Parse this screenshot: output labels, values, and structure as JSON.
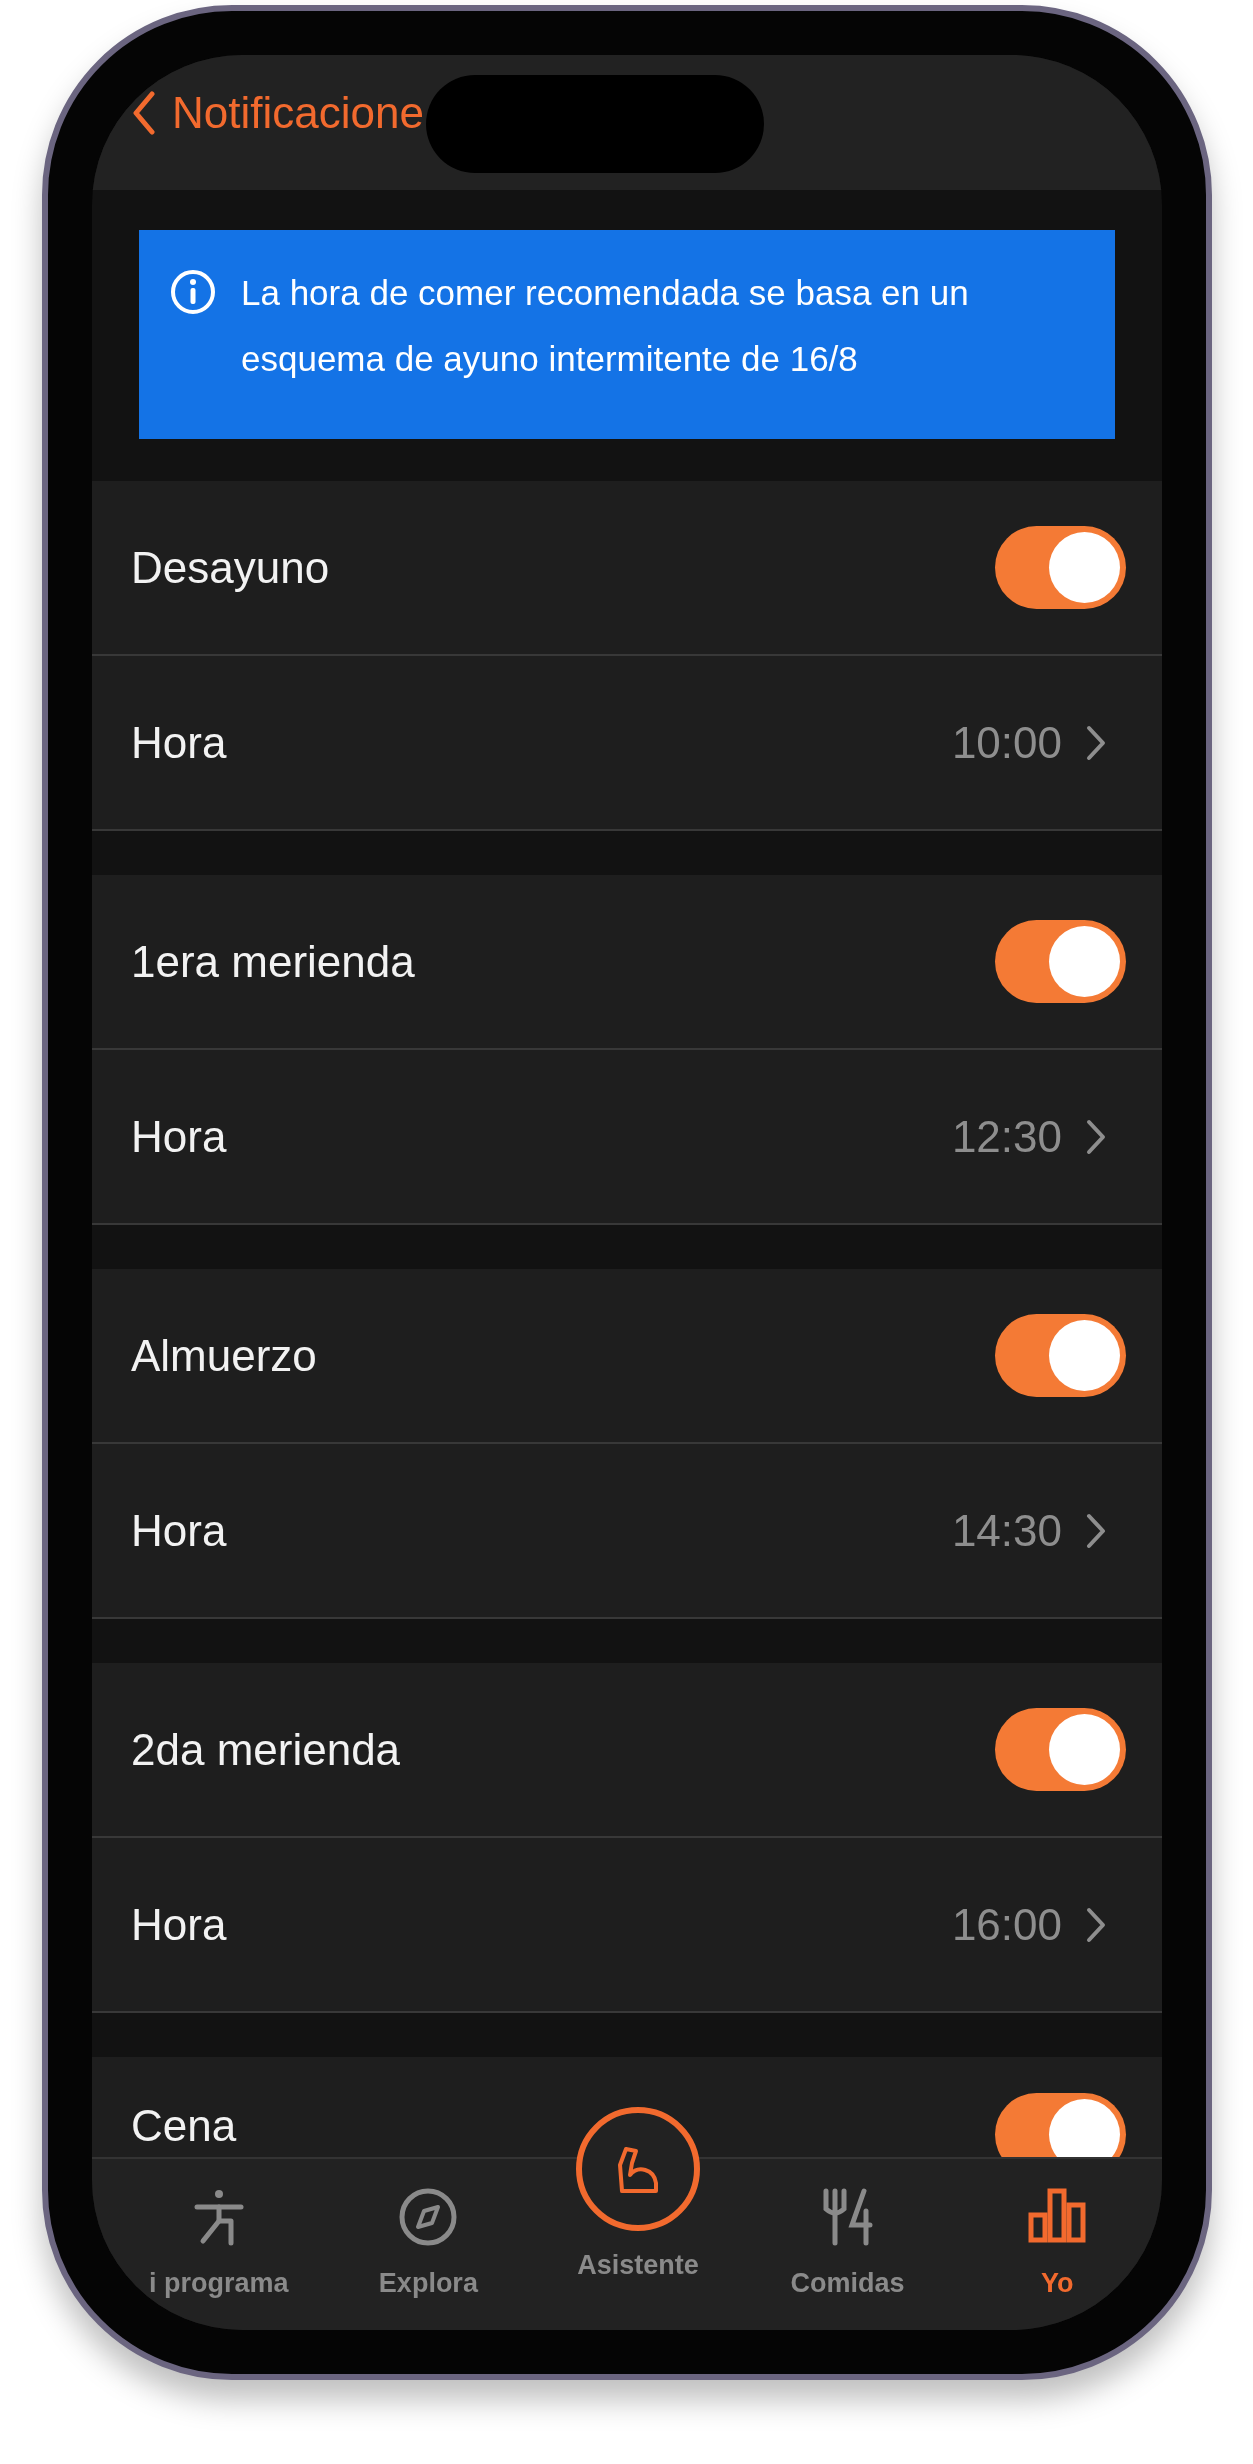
{
  "header": {
    "title": "Notificacione"
  },
  "banner": {
    "text": "La hora de comer recomendada se basa en un esquema de ayuno intermitente de 16/8"
  },
  "meals": [
    {
      "name": "Desayuno",
      "on": true,
      "time_label": "Hora",
      "time": "10:00"
    },
    {
      "name": "1era merienda",
      "on": true,
      "time_label": "Hora",
      "time": "12:30"
    },
    {
      "name": "Almuerzo",
      "on": true,
      "time_label": "Hora",
      "time": "14:30"
    },
    {
      "name": "2da merienda",
      "on": true,
      "time_label": "Hora",
      "time": "16:00"
    },
    {
      "name": "Cena",
      "on": true
    }
  ],
  "tabs": [
    {
      "label": "i programa",
      "kind": "figure",
      "selected": false
    },
    {
      "label": "Explora",
      "kind": "compass",
      "selected": false
    },
    {
      "label": "Asistente",
      "kind": "arm",
      "selected": false
    },
    {
      "label": "Comidas",
      "kind": "cutlery",
      "selected": false
    },
    {
      "label": "Yo",
      "kind": "chart",
      "selected": true
    }
  ]
}
